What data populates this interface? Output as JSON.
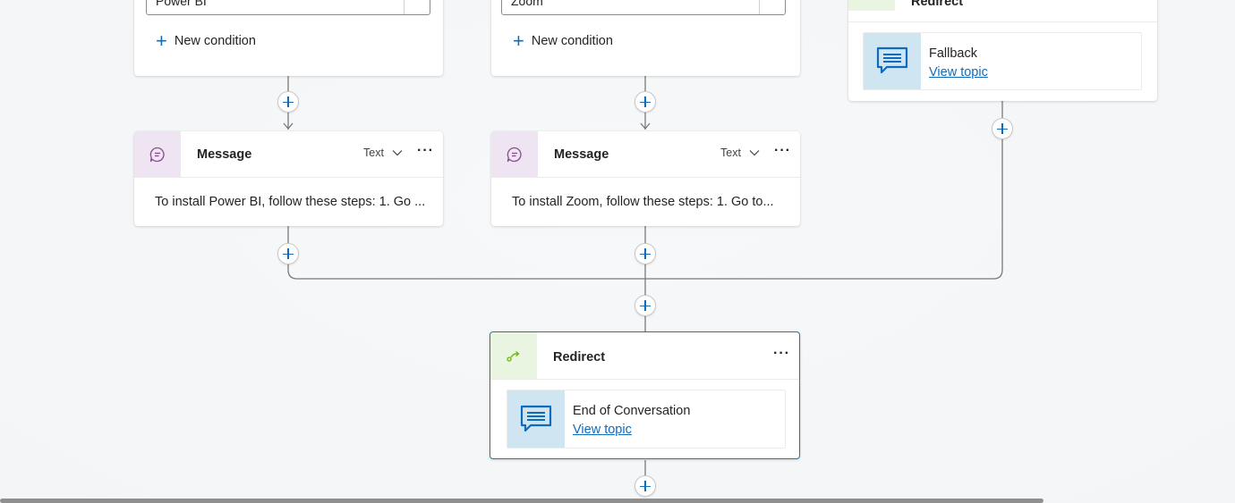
{
  "columns": [
    {
      "condition_value": "Power BI",
      "new_condition_label": "New condition",
      "message_title": "Message",
      "message_type": "Text",
      "message_text": "To install Power BI, follow these steps: 1. Go ..."
    },
    {
      "condition_value": "Zoom",
      "new_condition_label": "New condition",
      "message_title": "Message",
      "message_type": "Text",
      "message_text": "To install Zoom, follow these steps: 1. Go to..."
    }
  ],
  "fallback_branch": {
    "redirect_title": "Redirect",
    "topic_name": "Fallback",
    "view_topic_label": "View topic"
  },
  "end_redirect": {
    "title": "Redirect",
    "topic_name": "End of Conversation",
    "view_topic_label": "View topic"
  },
  "more_label": "···",
  "colors": {
    "accent": "#0f6cbd",
    "selected_border": "#1a7fa8",
    "message_icon_bg": "#efe4f2",
    "redirect_icon_bg": "#eaf5e1",
    "topic_icon_bg": "#cfe6f2",
    "connector": "#7a7a7a"
  },
  "icons": {
    "message": "chat-bubble-icon",
    "redirect": "redirect-arrow-icon",
    "topic": "topic-chat-icon",
    "add": "plus-icon",
    "more": "more-horizontal-icon",
    "chevron": "chevron-down-icon"
  }
}
